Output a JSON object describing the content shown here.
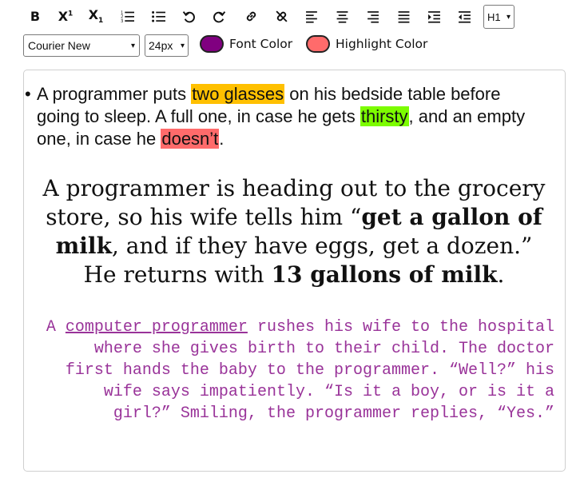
{
  "toolbar": {
    "bold_label": "B",
    "superscript_base": "X",
    "superscript_mark": "1",
    "subscript_base": "X",
    "subscript_mark": "1",
    "heading_select": {
      "selected": "H1"
    },
    "font_select": {
      "selected": "Courier New"
    },
    "size_select": {
      "selected": "24px"
    },
    "font_color": {
      "label": "Font Color",
      "value": "#800080"
    },
    "highlight_color": {
      "label": "Highlight Color",
      "value": "#ff6b6b"
    }
  },
  "editor": {
    "bullet": {
      "part1": "A programmer puts ",
      "hl1": "two glasses",
      "part2": " on his bedside table before going to sleep. A full one, in case he gets ",
      "hl2": "thirsty",
      "part3": ", and an empty one, in case he ",
      "hl3": "doesn’t",
      "part4": ".",
      "hl_colors": {
        "hl1": "#ffc000",
        "hl2": "#7cfc00",
        "hl3": "#ff6b6b"
      }
    },
    "serif_para": {
      "part1": "A programmer is heading out to the grocery store, so his wife tells him “",
      "bold1": "get a gallon of milk",
      "part2": ", and if they have eggs, get a dozen.” He returns with ",
      "bold2": "13 gallons of milk",
      "part3": "."
    },
    "mono_para": {
      "part1": "A ",
      "underlined": "computer programmer",
      "part2": " rushes his wife to the hospital where she gives birth to their child. The doctor first hands the baby to the programmer. “Well?” his wife says impatiently. “Is it a boy, or is it a girl?” Smiling, the programmer replies, “Yes.”",
      "color": "#993399"
    }
  }
}
